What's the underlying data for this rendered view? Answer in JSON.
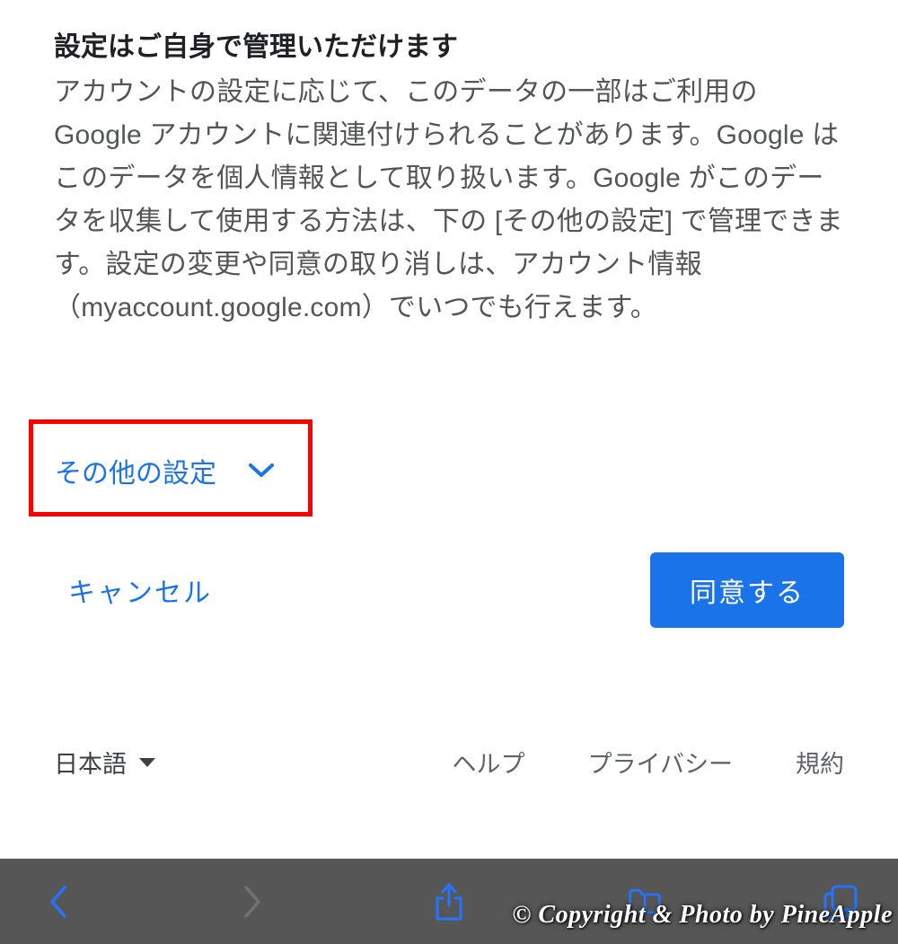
{
  "section": {
    "title": "設定はご自身で管理いただけます",
    "body": "アカウントの設定に応じて、このデータの一部はご利用の Google アカウントに関連付けられることがあります。Google はこのデータを個人情報として取り扱います。Google がこのデータを収集して使用する方法は、下の [その他の設定] で管理できます。設定の変更や同意の取り消しは、アカウント情報（myaccount.google.com）でいつでも行えます。"
  },
  "more_settings_label": "その他の設定",
  "actions": {
    "cancel": "キャンセル",
    "agree": "同意する"
  },
  "footer": {
    "language": "日本語",
    "help": "ヘルプ",
    "privacy": "プライバシー",
    "terms": "規約"
  },
  "watermark": "© Copyright & Photo by PineApple"
}
